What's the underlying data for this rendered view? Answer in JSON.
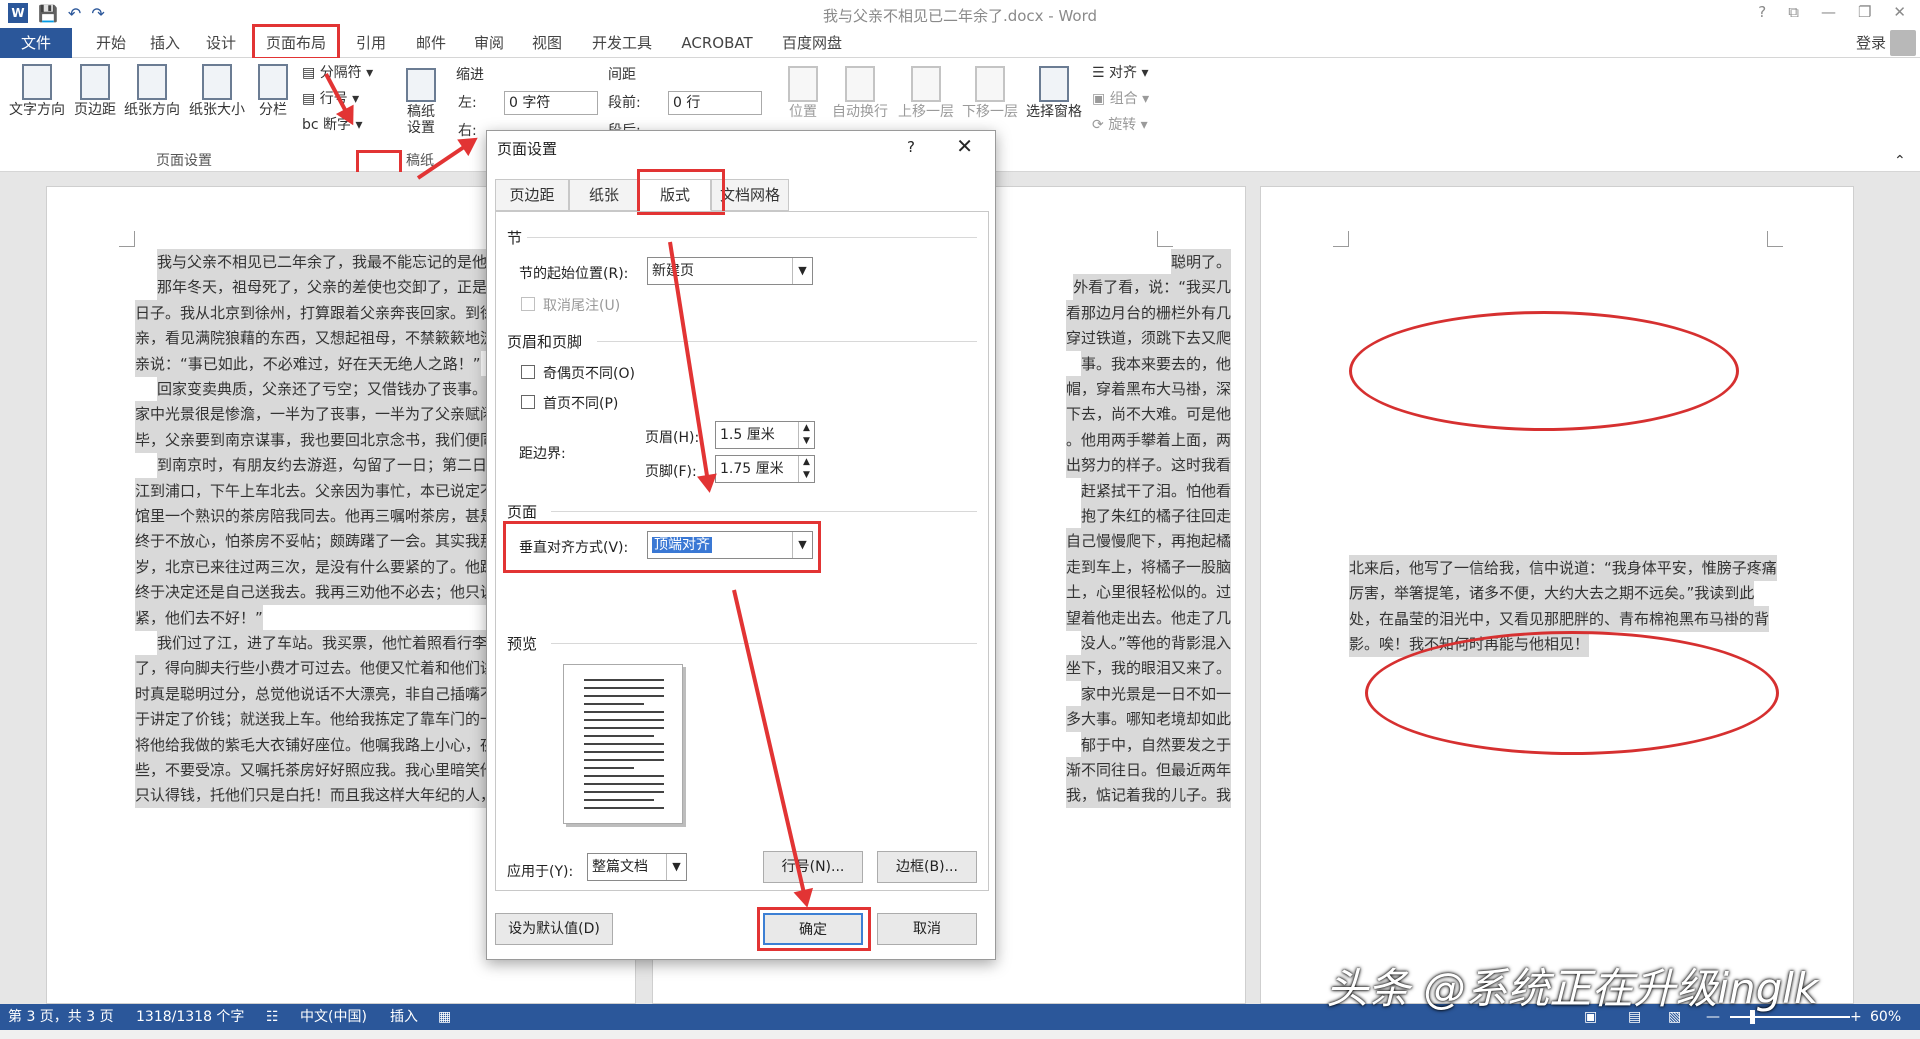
{
  "window": {
    "title": "我与父亲不相见已二年余了.docx - Word",
    "controls": [
      "?",
      "⧉",
      "—",
      "❐",
      "✕"
    ]
  },
  "qat": {
    "app_icon": "W",
    "save_icon": "save-icon",
    "undo_icon": "undo-icon",
    "redo_icon": "redo-icon"
  },
  "tabs": {
    "file": "文件",
    "home": "开始",
    "insert": "插入",
    "design": "设计",
    "layout": "页面布局",
    "references": "引用",
    "mailings": "邮件",
    "review": "审阅",
    "view": "视图",
    "developer": "开发工具",
    "acrobat": "ACROBAT",
    "baidu": "百度网盘",
    "login": "登录"
  },
  "ribbon": {
    "text_direction": "文字方向",
    "margins": "页边距",
    "orientation": "纸张方向",
    "size": "纸张大小",
    "columns": "分栏",
    "breaks": "分隔符",
    "line_numbers": "行号",
    "hyphenation": "断字",
    "group_page_setup": "页面设置",
    "draft_settings_1": "稿纸",
    "draft_settings_2": "设置",
    "group_draft": "稿纸",
    "indent_header": "缩进",
    "spacing_header": "间距",
    "indent_left_label": "左:",
    "indent_left_value": "0 字符",
    "spacing_before_label": "段前:",
    "spacing_before_value": "0 行",
    "indent_right_label": "右:",
    "spacing_after_label": "段后:",
    "position": "位置",
    "wrap_text": "自动换行",
    "bring_forward": "上移一层",
    "send_backward": "下移一层",
    "selection_pane": "选择窗格",
    "align": "对齐",
    "group": "组合",
    "rotate": "旋转"
  },
  "document": {
    "left_lines": [
      "我与父亲不相见已二年余了，我最不能忘记的是他的背",
      "那年冬天，祖母死了，父亲的差使也交卸了，正是祸不",
      "日子。我从北京到徐州，打算跟着父亲奔丧回家。到徐州",
      "亲，看见满院狼藉的东西，又想起祖母，不禁簌簌地流下",
      "亲说：“事已如此，不必难过，好在天无绝人之路！”",
      "回家变卖典质，父亲还了亏空；又借钱办了丧事。这些",
      "家中光景很是惨澹，一半为了丧事，一半为了父亲赋闲。",
      "毕，父亲要到南京谋事，我也要回北京念书，我们便同行",
      "到南京时，有朋友约去游逛，勾留了一日；第二日上午",
      "江到浦口，下午上车北去。父亲因为事忙，本已说定不送",
      "馆里一个熟识的茶房陪我同去。他再三嘱咐茶房，甚是仔",
      "终于不放心，怕茶房不妥帖；颇踌躇了一会。其实我那年",
      "岁，北京已来往过两三次，是没有什么要紧的了。他踌躇",
      "终于决定还是自己送我去。我再三劝他不必去；他只说：",
      "紧，他们去不好！”",
      "我们过了江，进了车站。我买票，他忙着照看行李。行",
      "了，得向脚夫行些小费才可过去。他便又忙着和他们讲价",
      "时真是聪明过分，总觉他说话不大漂亮，非自己插嘴不可",
      "于讲定了价钱；就送我上车。他给我拣定了靠车门的一张",
      "将他给我做的紫毛大衣铺好座位。他嘱我路上小心，夜里",
      "些，不要受凉。又嘱托茶房好好照应我。我心里暗笑他的",
      "只认得钱，托他们只是白托！而且我这样大年纪的人，难"
    ],
    "right_fragments": [
      "聪明了。",
      "外看了看，说：“我买几",
      "看那边月台的栅栏外有几",
      "穿过铁道，须跳下去又爬",
      "事。我本来要去的，他",
      "帽，穿着黑布大马褂，深",
      "下去，尚不大难。可是他",
      "。他用两手攀着上面，两",
      "出努力的样子。这时我看",
      "赶紧拭干了泪。怕他看",
      "抱了朱红的橘子往回走",
      "自己慢慢爬下，再抱起橘",
      "走到车上，将橘子一股脑",
      "土，心里很轻松似的。过",
      "望着他走出去。他走了几",
      "没人。”等他的背影混入",
      "坐下，我的眼泪又来了。",
      "家中光景是一日不如一",
      "多大事。哪知老境却如此",
      "郁于中，自然要发之于",
      "渐不同往日。但最近两年",
      "我，惦记着我的儿子。我"
    ],
    "page3_lines": [
      "北来后，他写了一信给我，信中说道：“我身体平安，惟膀子疼痛",
      "厉害，举箸提笔，诸多不便，大约大去之期不远矣。”我读到此",
      "处，在晶莹的泪光中，又看见那肥胖的、青布棉袍黑布马褂的背",
      "影。唉！我不知何时再能与他相见！"
    ]
  },
  "dialog": {
    "title": "页面设置",
    "help": "?",
    "close": "✕",
    "tabs": [
      "页边距",
      "纸张",
      "版式",
      "文档网格"
    ],
    "section_label": "节",
    "section_start_label": "节的起始位置(R):",
    "section_start_value": "新建页",
    "suppress_endnotes": "取消尾注(U)",
    "headers_footers_label": "页眉和页脚",
    "odd_even": "奇偶页不同(O)",
    "first_page": "首页不同(P)",
    "from_edge": "距边界:",
    "header_label": "页眉(H):",
    "header_value": "1.5 厘米",
    "footer_label": "页脚(F):",
    "footer_value": "1.75 厘米",
    "page_label": "页面",
    "vertical_align_label": "垂直对齐方式(V):",
    "vertical_align_value": "顶端对齐",
    "preview_label": "预览",
    "apply_to_label": "应用于(Y):",
    "apply_to_value": "整篇文档",
    "line_numbers_btn": "行号(N)...",
    "borders_btn": "边框(B)...",
    "set_default_btn": "设为默认值(D)",
    "ok_btn": "确定",
    "cancel_btn": "取消"
  },
  "status": {
    "page": "第 3 页，共 3 页",
    "words": "1318/1318 个字",
    "language": "中文(中国)",
    "mode": "插入",
    "zoom": "60%"
  },
  "watermark": "头条 @系统正在升级inglk",
  "colors": {
    "accent": "#2b579a",
    "highlight": "#e23434",
    "ellipse": "#d63030"
  }
}
